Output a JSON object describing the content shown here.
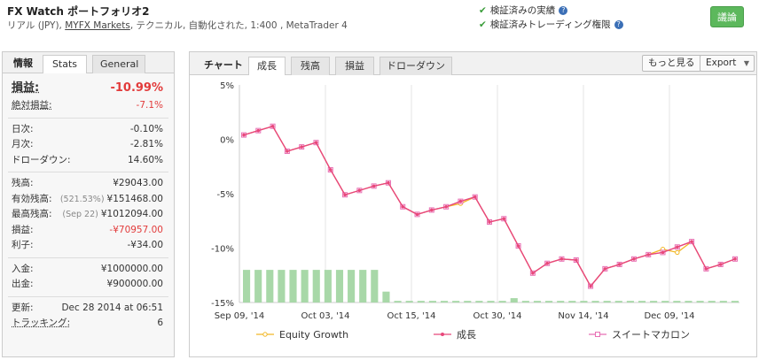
{
  "header": {
    "title": "FX Watch ポートフォリオ2",
    "sub_prefix": "リアル (JPY), ",
    "sub_link": "MYFX Markets",
    "sub_suffix": ", テクニカル, 自動化された, 1:400 , MetaTrader 4",
    "verify1": "検証済みの実績",
    "verify2": "検証済みトレーディング権限",
    "discuss_label": "議論"
  },
  "left_panel": {
    "tab_info": "情報",
    "tab_stats": "Stats",
    "tab_general": "General",
    "gain_label": "損益:",
    "gain_value": "-10.99%",
    "abs_gain_label": "絶対損益:",
    "abs_gain_value": "-7.1%",
    "daily_label": "日次:",
    "daily_value": "-0.10%",
    "monthly_label": "月次:",
    "monthly_value": "-2.81%",
    "drawdown_label": "ドローダウン:",
    "drawdown_value": "14.60%",
    "balance_label": "残高:",
    "balance_value": "¥29043.00",
    "equity_label": "有効残高:",
    "equity_pct": "(521.53%)",
    "equity_value": "¥151468.00",
    "highest_label": "最高残高:",
    "highest_date": "(Sep 22)",
    "highest_value": "¥1012094.00",
    "profit_label": "損益:",
    "profit_value": "-¥70957.00",
    "interest_label": "利子:",
    "interest_value": "-¥34.00",
    "deposits_label": "入金:",
    "deposits_value": "¥1000000.00",
    "withdrawals_label": "出金:",
    "withdrawals_value": "¥900000.00",
    "updated_label": "更新:",
    "updated_value": "Dec 28 2014 at 06:51",
    "tracking_label": "トラッキング:",
    "tracking_value": "6"
  },
  "chart_panel": {
    "label": "チャート",
    "tabs": [
      "成長",
      "残高",
      "損益",
      "ドローダウン"
    ],
    "more_button": "もっと見る",
    "export_button": "Export"
  },
  "colors": {
    "growth": "#e8477a",
    "equity_growth": "#f2b827",
    "sweet": "#e86fb4",
    "bars": "#a8d8a8",
    "negative": "#e23b3b",
    "green_button": "#5cb85c"
  },
  "chart_data": {
    "type": "line",
    "title": "",
    "ylim": [
      -15,
      5
    ],
    "y_ticks": [
      "5%",
      "0%",
      "-5%",
      "-10%",
      "-15%"
    ],
    "x_ticks": [
      "Sep 09, '14",
      "Oct 03, '14",
      "Oct 15, '14",
      "Oct 30, '14",
      "Nov 14, '14",
      "Dec 09, '14"
    ],
    "series": [
      {
        "name": "Equity Growth",
        "values": [
          0.4,
          0.8,
          1.2,
          -1.1,
          -0.7,
          -0.3,
          -2.8,
          -5.1,
          -4.7,
          -4.3,
          -4.0,
          -6.2,
          -6.9,
          -6.5,
          -6.2,
          -5.9,
          -5.3,
          -7.6,
          -7.3,
          -9.8,
          -12.3,
          -11.4,
          -11.0,
          -11.1,
          -13.5,
          -11.9,
          -11.5,
          -11.0,
          -10.6,
          -10.1,
          -10.4,
          -9.4,
          -11.9,
          -11.5,
          -11.0
        ]
      },
      {
        "name": "成長",
        "values": [
          0.4,
          0.8,
          1.2,
          -1.1,
          -0.7,
          -0.3,
          -2.8,
          -5.1,
          -4.7,
          -4.3,
          -4.0,
          -6.2,
          -6.9,
          -6.5,
          -6.2,
          -5.7,
          -5.3,
          -7.6,
          -7.3,
          -9.8,
          -12.3,
          -11.4,
          -11.0,
          -11.1,
          -13.5,
          -11.9,
          -11.5,
          -11.0,
          -10.6,
          -10.4,
          -9.9,
          -9.4,
          -11.9,
          -11.5,
          -11.0
        ]
      },
      {
        "name": "スイートマカロン",
        "values": [
          0.4,
          0.8,
          1.2,
          -1.1,
          -0.7,
          -0.3,
          -2.8,
          -5.1,
          -4.7,
          -4.3,
          -4.0,
          -6.2,
          -6.9,
          -6.5,
          -6.2,
          -5.7,
          -5.3,
          -7.6,
          -7.3,
          -9.8,
          -12.3,
          -11.4,
          -11.0,
          -11.1,
          -13.5,
          -11.9,
          -11.5,
          -11.0,
          -10.6,
          -10.4,
          -9.9,
          -9.4,
          -11.9,
          -11.5,
          -11.0
        ]
      }
    ],
    "bars": {
      "values": [
        3,
        3,
        3,
        3,
        3,
        3,
        3,
        3,
        3,
        3,
        3,
        3,
        1,
        0.15,
        0.15,
        0.15,
        0.15,
        0.15,
        0.15,
        0.15,
        0.15,
        0.15,
        0.15,
        0.4,
        0.15,
        0.15,
        0.15,
        0.15,
        0.15,
        0.15,
        0.15,
        0.15,
        0.15,
        0.15,
        0.15,
        0.15,
        0.15,
        0.15,
        0.15,
        0.15,
        0.15,
        0.15,
        0.15
      ]
    }
  }
}
